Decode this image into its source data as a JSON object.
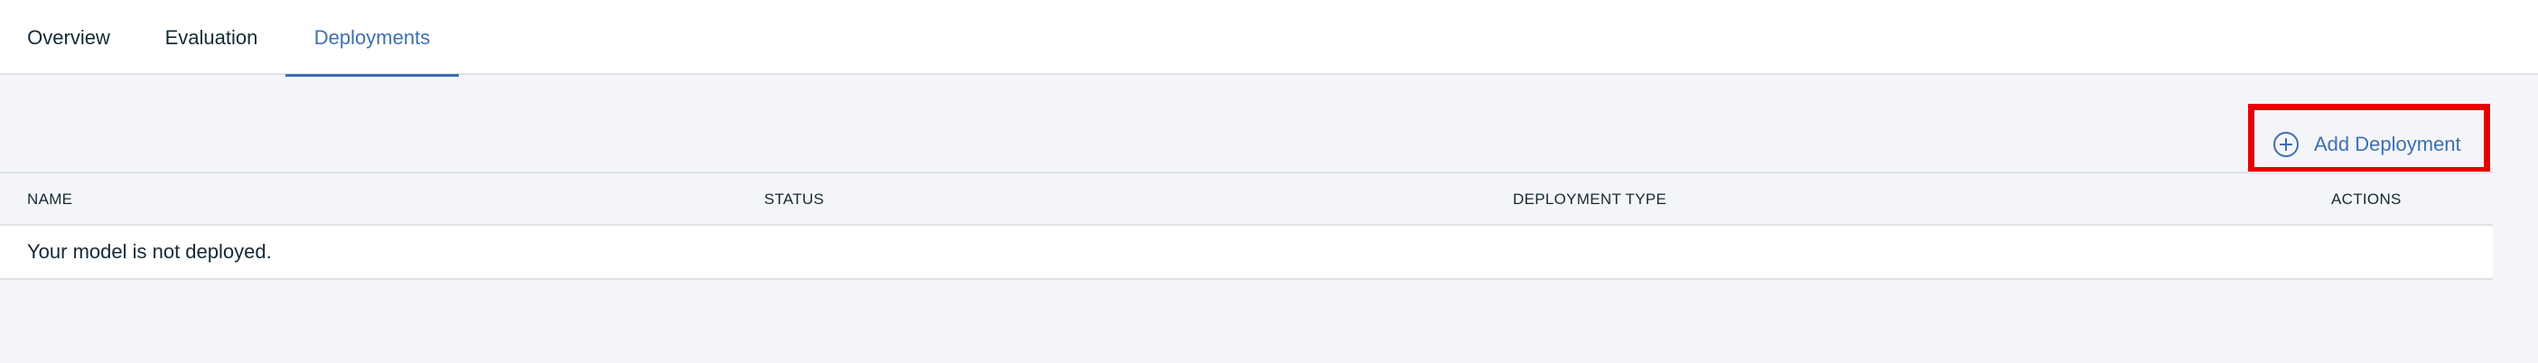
{
  "tabs": [
    {
      "label": "Overview",
      "active": false
    },
    {
      "label": "Evaluation",
      "active": false
    },
    {
      "label": "Deployments",
      "active": true
    }
  ],
  "toolbar": {
    "add_label": "Add Deployment",
    "add_icon": "add-circle-icon"
  },
  "table": {
    "columns": [
      "NAME",
      "STATUS",
      "DEPLOYMENT TYPE",
      "ACTIONS"
    ],
    "empty_message": "Your model is not deployed."
  },
  "colors": {
    "accent": "#3d70b2",
    "highlight": "#e60000",
    "background": "#f4f5f8",
    "text": "#152935",
    "border": "#dfe3e6"
  }
}
